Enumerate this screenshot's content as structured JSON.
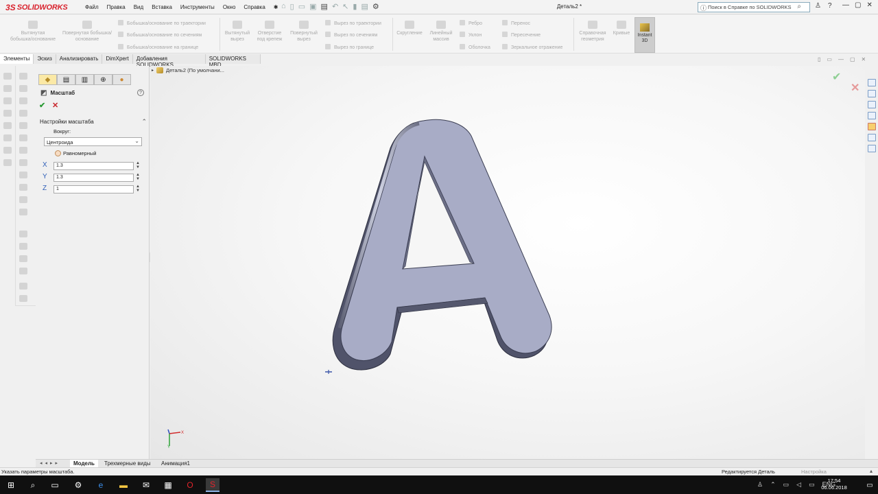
{
  "app": {
    "brand": "SOLIDWORKS",
    "document_title": "Деталь2 *",
    "menu": [
      "Файл",
      "Правка",
      "Вид",
      "Вставка",
      "Инструменты",
      "Окно",
      "Справка"
    ],
    "help_search_placeholder": "Поиск в Справке по SOLIDWORKS"
  },
  "command_manager": {
    "extruded_boss": "Вытянутая бобышка/основание",
    "revolved_boss": "Повернутая бобышка/основание",
    "sweep_boss": "Бобышка/основание по траектории",
    "loft_boss": "Бобышка/основание по сечениям",
    "boundary_boss": "Бобышка/основание на границе",
    "extruded_cut": "Вытянутый вырез",
    "hole_wizard": "Отверстие под крепеж",
    "revolved_cut": "Повернутый вырез",
    "sweep_cut": "Вырез по траектории",
    "loft_cut": "Вырез по сечениям",
    "boundary_cut": "Вырез по границе",
    "fillet": "Скругление",
    "linear_pattern": "Линейный массив",
    "rib": "Ребро",
    "draft": "Уклон",
    "shell": "Оболочка",
    "wrap": "Перенос",
    "intersect": "Пересечение",
    "mirror": "Зеркальное отражение",
    "ref_geometry": "Справочная геометрия",
    "curves": "Кривые",
    "instant3d": "Instant 3D"
  },
  "tabs": [
    "Элементы",
    "Эскиз",
    "Анализировать",
    "DimXpert",
    "Добавления SOLIDWORKS",
    "SOLIDWORKS MBD"
  ],
  "property_manager": {
    "title": "Масштаб",
    "group_title": "Настройки масштаба",
    "about_label": "Вокруг:",
    "about_value": "Центроида",
    "uniform_label": "Равномерный",
    "x_label": "X",
    "y_label": "Y",
    "z_label": "Z",
    "x_value": "1.3",
    "y_value": "1.3",
    "z_value": "1"
  },
  "tree": {
    "root": "Деталь2  (По умолчани..."
  },
  "bottom_tabs": [
    "Модель",
    "Трехмерные виды",
    "Анимация1"
  ],
  "status": {
    "message": "Указать параметры масштаба.",
    "editing": "Редактируется Деталь",
    "settings": "Настройка"
  },
  "taskbar": {
    "lang": "ENG",
    "time": "17:54",
    "date": "06.06.2018"
  },
  "colors": {
    "brand_red": "#d9232e",
    "part_face": "#a8acc6",
    "ok_green": "#2a9a34",
    "cancel_red": "#c8252b"
  }
}
